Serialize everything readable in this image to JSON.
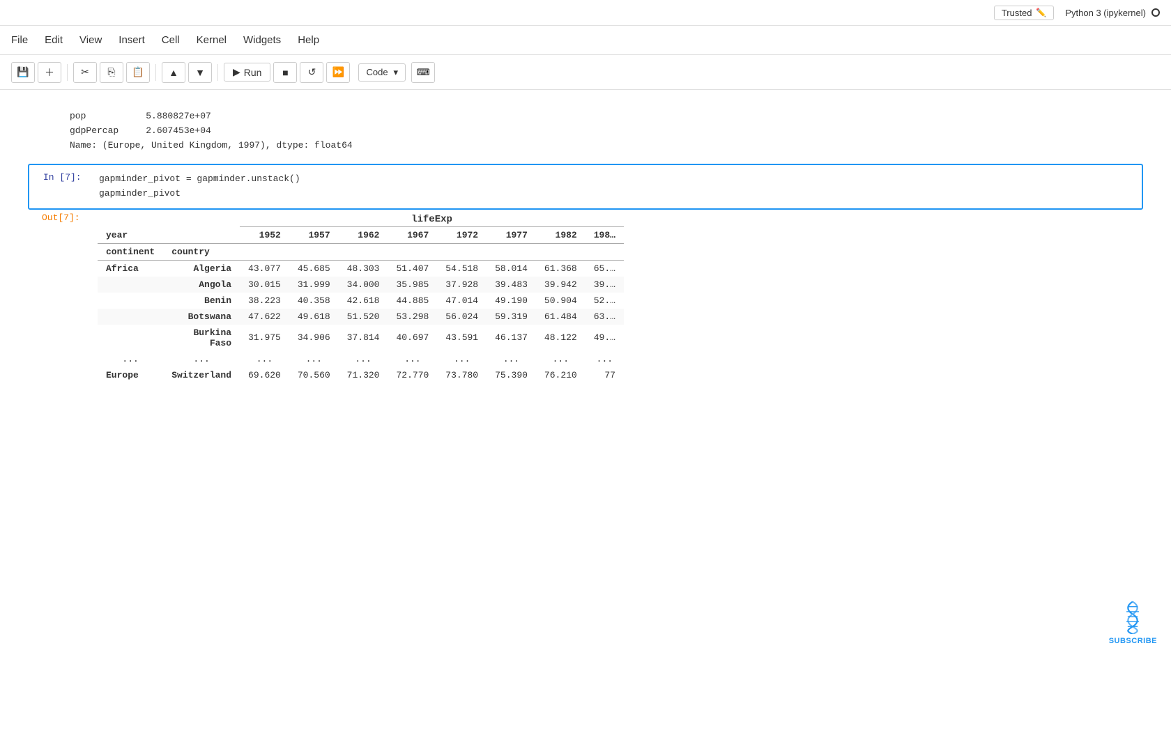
{
  "topbar": {
    "trusted_label": "Trusted",
    "kernel_label": "Python 3 (ipykernel)"
  },
  "menubar": {
    "items": [
      "File",
      "Edit",
      "View",
      "Insert",
      "Cell",
      "Kernel",
      "Widgets",
      "Help"
    ]
  },
  "toolbar": {
    "cell_type": "Code",
    "run_label": "Run"
  },
  "prev_output": {
    "lines": [
      "pop           5.880827e+07",
      "gdpPercap     2.607453e+04",
      "Name: (Europe, United Kingdom, 1997), dtype: float64"
    ]
  },
  "cell7": {
    "prompt": "In [7]:",
    "code_line1": "gapminder_pivot = gapminder.unstack()",
    "code_line2": "gapminder_pivot"
  },
  "out7": {
    "prompt": "Out[7]:"
  },
  "table": {
    "top_header": "lifeExp",
    "year_label": "year",
    "years": [
      "1952",
      "1957",
      "1962",
      "1967",
      "1972",
      "1977",
      "1982",
      "198…"
    ],
    "continent_label": "continent",
    "country_label": "country",
    "rows": [
      {
        "continent": "Africa",
        "country": "Algeria",
        "values": [
          "43.077",
          "45.685",
          "48.303",
          "51.407",
          "54.518",
          "58.014",
          "61.368",
          "65.…"
        ]
      },
      {
        "continent": "",
        "country": "Angola",
        "values": [
          "30.015",
          "31.999",
          "34.000",
          "35.985",
          "37.928",
          "39.483",
          "39.942",
          "39.…"
        ]
      },
      {
        "continent": "",
        "country": "Benin",
        "values": [
          "38.223",
          "40.358",
          "42.618",
          "44.885",
          "47.014",
          "49.190",
          "50.904",
          "52.…"
        ]
      },
      {
        "continent": "",
        "country": "Botswana",
        "values": [
          "47.622",
          "49.618",
          "51.520",
          "53.298",
          "56.024",
          "59.319",
          "61.484",
          "63.…"
        ]
      },
      {
        "continent": "",
        "country": "Burkina\nFaso",
        "values": [
          "31.975",
          "34.906",
          "37.814",
          "40.697",
          "43.591",
          "46.137",
          "48.122",
          "49.…"
        ]
      }
    ],
    "ellipsis": [
      "...",
      "...",
      "...",
      "...",
      "...",
      "...",
      "...",
      "...",
      "..."
    ],
    "bottom_row": {
      "continent": "Europe",
      "country": "Switzerland",
      "values": [
        "69.620",
        "70.560",
        "71.320",
        "72.770",
        "73.780",
        "75.390",
        "76.210",
        "77"
      ]
    }
  }
}
